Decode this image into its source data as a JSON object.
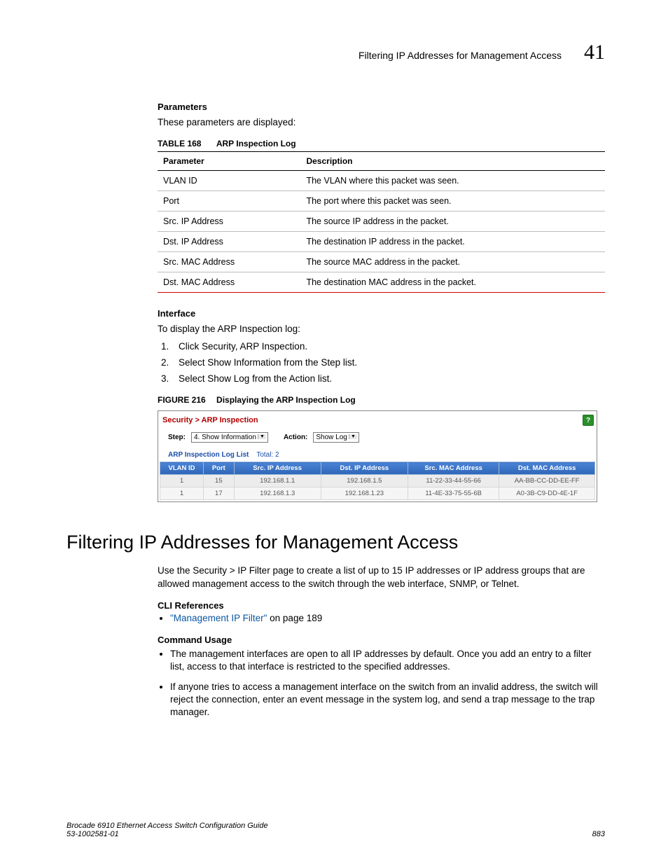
{
  "header": {
    "running_title": "Filtering IP Addresses for Management Access",
    "chapter_number": "41"
  },
  "parameters": {
    "heading": "Parameters",
    "intro": "These parameters are displayed:",
    "table_caption_label": "TABLE 168",
    "table_caption_title": "ARP Inspection Log",
    "columns": [
      "Parameter",
      "Description"
    ],
    "rows": [
      {
        "param": "VLAN ID",
        "desc": "The VLAN where this packet was seen."
      },
      {
        "param": "Port",
        "desc": "The port where this packet was seen."
      },
      {
        "param": "Src. IP Address",
        "desc": "The source IP address in the packet."
      },
      {
        "param": "Dst. IP Address",
        "desc": "The destination IP address in the packet."
      },
      {
        "param": "Src. MAC Address",
        "desc": "The source MAC address in the packet."
      },
      {
        "param": "Dst. MAC Address",
        "desc": "The destination MAC address in the packet."
      }
    ]
  },
  "interface": {
    "heading": "Interface",
    "intro": "To display the ARP Inspection log:",
    "steps": [
      "Click Security, ARP Inspection.",
      "Select Show Information from the Step list.",
      "Select Show Log from the Action list."
    ]
  },
  "figure": {
    "caption_label": "FIGURE 216",
    "caption_title": "Displaying the ARP Inspection Log",
    "breadcrumb": "Security > ARP Inspection",
    "help_glyph": "?",
    "step_label": "Step:",
    "step_value": "4. Show Information",
    "action_label": "Action:",
    "action_value": "Show Log",
    "list_title": "ARP Inspection Log List",
    "list_total_label": "Total: 2",
    "columns": [
      "VLAN ID",
      "Port",
      "Src. IP Address",
      "Dst. IP Address",
      "Src. MAC Address",
      "Dst. MAC Address"
    ],
    "rows": [
      {
        "vlan": "1",
        "port": "15",
        "src_ip": "192.168.1.1",
        "dst_ip": "192.168.1.5",
        "src_mac": "11-22-33-44-55-66",
        "dst_mac": "AA-BB-CC-DD-EE-FF"
      },
      {
        "vlan": "1",
        "port": "17",
        "src_ip": "192.168.1.3",
        "dst_ip": "192.168.1.23",
        "src_mac": "11-4E-33-75-55-6B",
        "dst_mac": "A0-3B-C9-DD-4E-1F"
      }
    ]
  },
  "section": {
    "title": "Filtering IP Addresses for Management Access",
    "intro": "Use the Security > IP Filter page to create a list of up to 15 IP addresses or IP address groups that are allowed management access to the switch through the web interface, SNMP, or Telnet.",
    "cli_heading": "CLI References",
    "cli_link_text": "\"Management IP Filter\"",
    "cli_link_suffix": " on page 189",
    "usage_heading": "Command Usage",
    "usage_items": [
      "The management interfaces are open to all IP addresses by default. Once you add an entry to a filter list, access to that interface is restricted to the specified addresses.",
      "If anyone tries to access a management interface on the switch from an invalid address, the switch will reject the connection, enter an event message in the system log, and send a trap message to the trap manager."
    ]
  },
  "footer": {
    "book_title": "Brocade 6910 Ethernet Access Switch Configuration Guide",
    "doc_number": "53-1002581-01",
    "page_number": "883"
  }
}
